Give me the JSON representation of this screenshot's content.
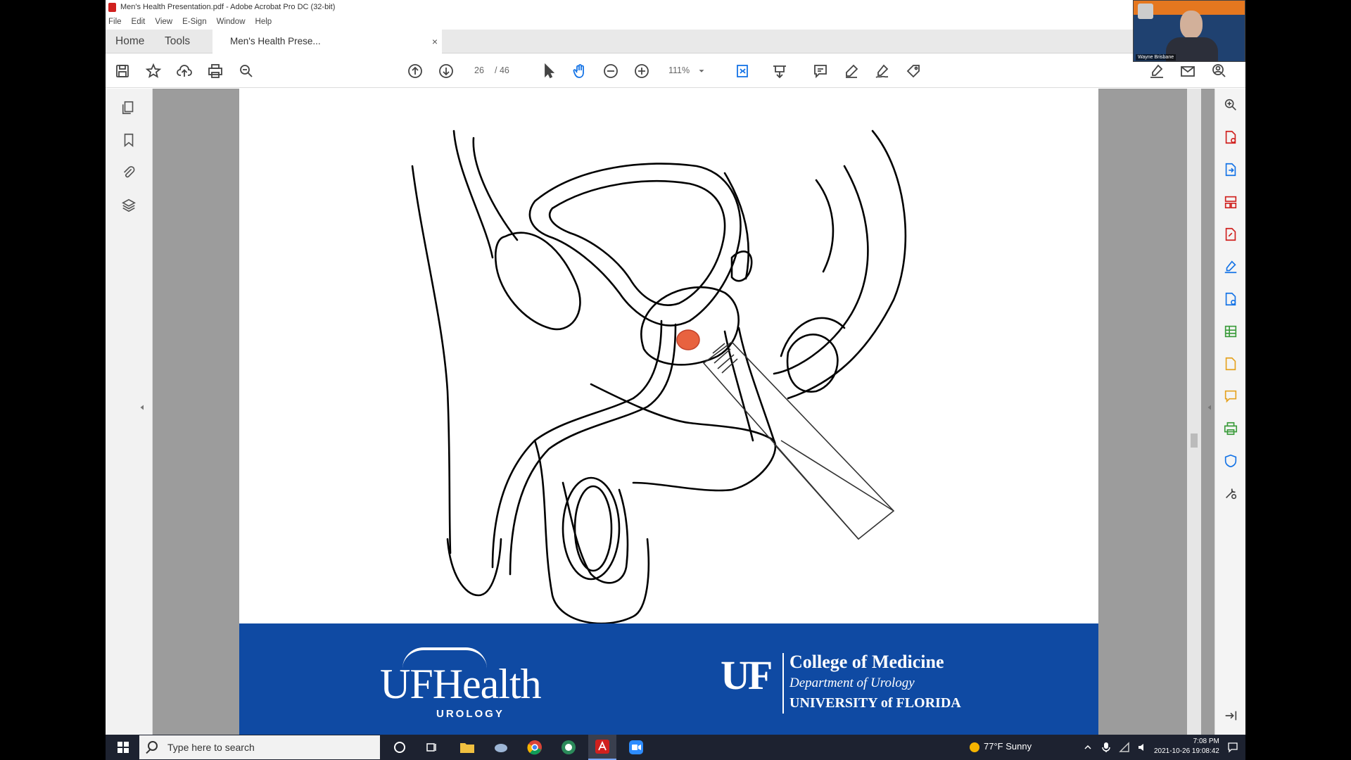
{
  "window": {
    "title": "Men's Health Presentation.pdf - Adobe Acrobat Pro DC (32-bit)"
  },
  "menu": [
    "File",
    "Edit",
    "View",
    "E-Sign",
    "Window",
    "Help"
  ],
  "tabs": {
    "home": "Home",
    "tools": "Tools",
    "doc": "Men's Health Prese...",
    "close": "×"
  },
  "toolbar": {
    "page_current": "26",
    "page_total": "/  46",
    "zoom": "111%"
  },
  "slide": {
    "footer": {
      "uf_health": "UFHealth",
      "urology": "UROLOGY",
      "uf": "UF",
      "college": "College of Medicine",
      "department": "Department of Urology",
      "university": "UNIVERSITY of FLORIDA"
    }
  },
  "webcam": {
    "name": "Wayne Brisbane"
  },
  "taskbar": {
    "search_placeholder": "Type here to search",
    "weather": "77°F  Sunny",
    "time": "7:08 PM",
    "date": "2021-10-26  19:08:42"
  },
  "colors": {
    "banner_blue": "#0f4aa3",
    "lesion": "#e8623f",
    "acrobat_red": "#d0201e"
  }
}
